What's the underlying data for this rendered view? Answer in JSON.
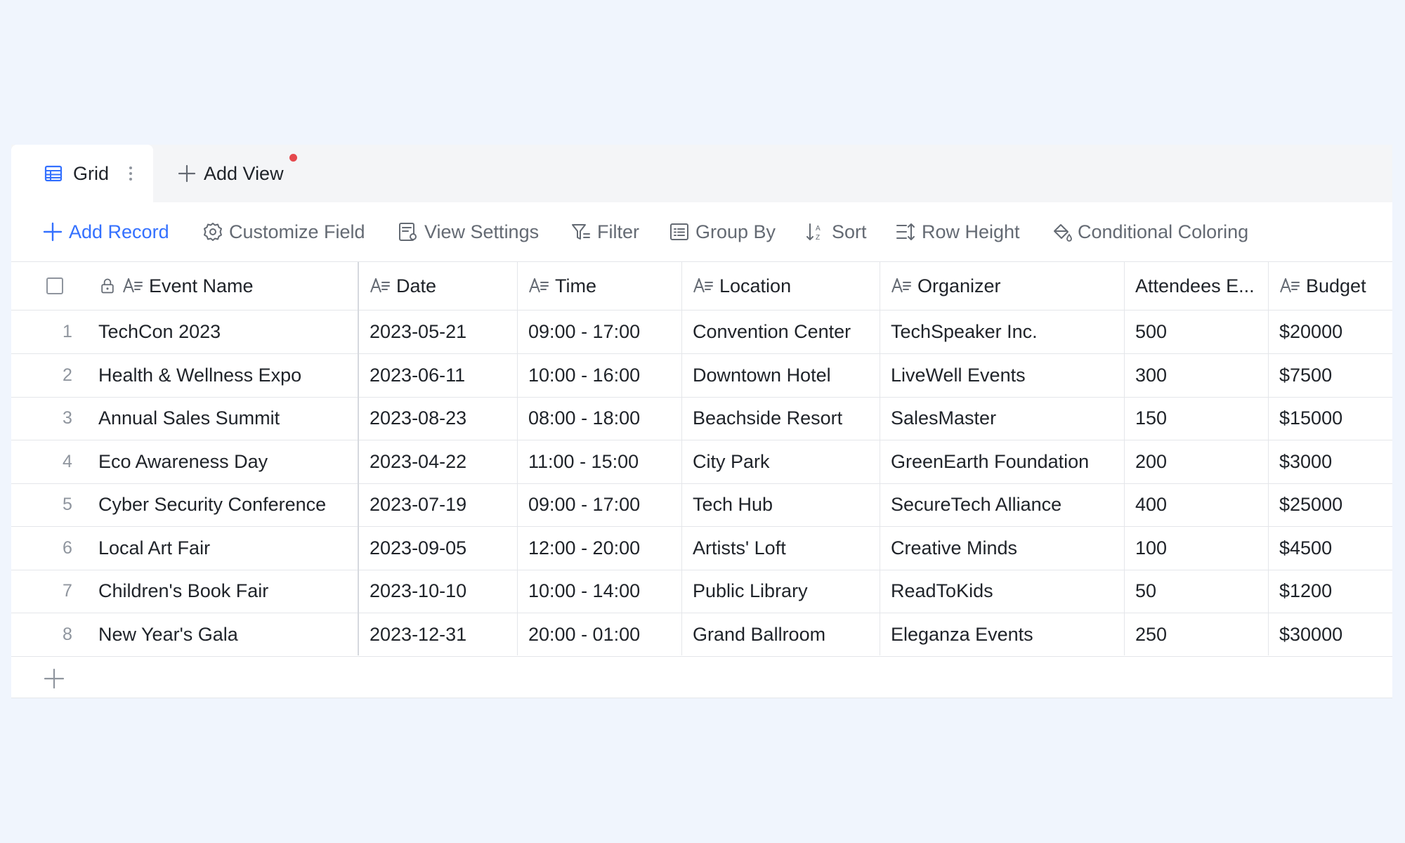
{
  "tabs": {
    "active_label": "Grid",
    "add_view_label": "Add View"
  },
  "toolbar": {
    "add_record": "Add Record",
    "customize_field": "Customize Field",
    "view_settings": "View Settings",
    "filter": "Filter",
    "group_by": "Group By",
    "sort": "Sort",
    "row_height": "Row Height",
    "conditional_coloring": "Conditional Coloring"
  },
  "colors": {
    "accent": "#3370ff",
    "notification_dot": "#e5484d",
    "page_background": "#f0f5fd"
  },
  "table": {
    "columns": [
      "Event Name",
      "Date",
      "Time",
      "Location",
      "Organizer",
      "Attendees E...",
      "Budget"
    ],
    "rows": [
      {
        "num": "1",
        "cells": [
          "TechCon 2023",
          "2023-05-21",
          "09:00 - 17:00",
          "Convention Center",
          "TechSpeaker Inc.",
          "500",
          "$20000"
        ]
      },
      {
        "num": "2",
        "cells": [
          "Health & Wellness Expo",
          "2023-06-11",
          "10:00 - 16:00",
          "Downtown Hotel",
          "LiveWell Events",
          "300",
          "$7500"
        ]
      },
      {
        "num": "3",
        "cells": [
          "Annual Sales Summit",
          "2023-08-23",
          "08:00 - 18:00",
          "Beachside Resort",
          "SalesMaster",
          "150",
          "$15000"
        ]
      },
      {
        "num": "4",
        "cells": [
          "Eco Awareness Day",
          "2023-04-22",
          "11:00 - 15:00",
          "City Park",
          "GreenEarth Foundation",
          "200",
          "$3000"
        ]
      },
      {
        "num": "5",
        "cells": [
          "Cyber Security Conference",
          "2023-07-19",
          "09:00 - 17:00",
          "Tech Hub",
          "SecureTech Alliance",
          "400",
          "$25000"
        ]
      },
      {
        "num": "6",
        "cells": [
          "Local Art Fair",
          "2023-09-05",
          "12:00 - 20:00",
          "Artists' Loft",
          "Creative Minds",
          "100",
          "$4500"
        ]
      },
      {
        "num": "7",
        "cells": [
          "Children's Book Fair",
          "2023-10-10",
          "10:00 - 14:00",
          "Public Library",
          "ReadToKids",
          "50",
          "$1200"
        ]
      },
      {
        "num": "8",
        "cells": [
          "New Year's Gala",
          "2023-12-31",
          "20:00 - 01:00",
          "Grand Ballroom",
          "Eleganza Events",
          "250",
          "$30000"
        ]
      }
    ]
  }
}
